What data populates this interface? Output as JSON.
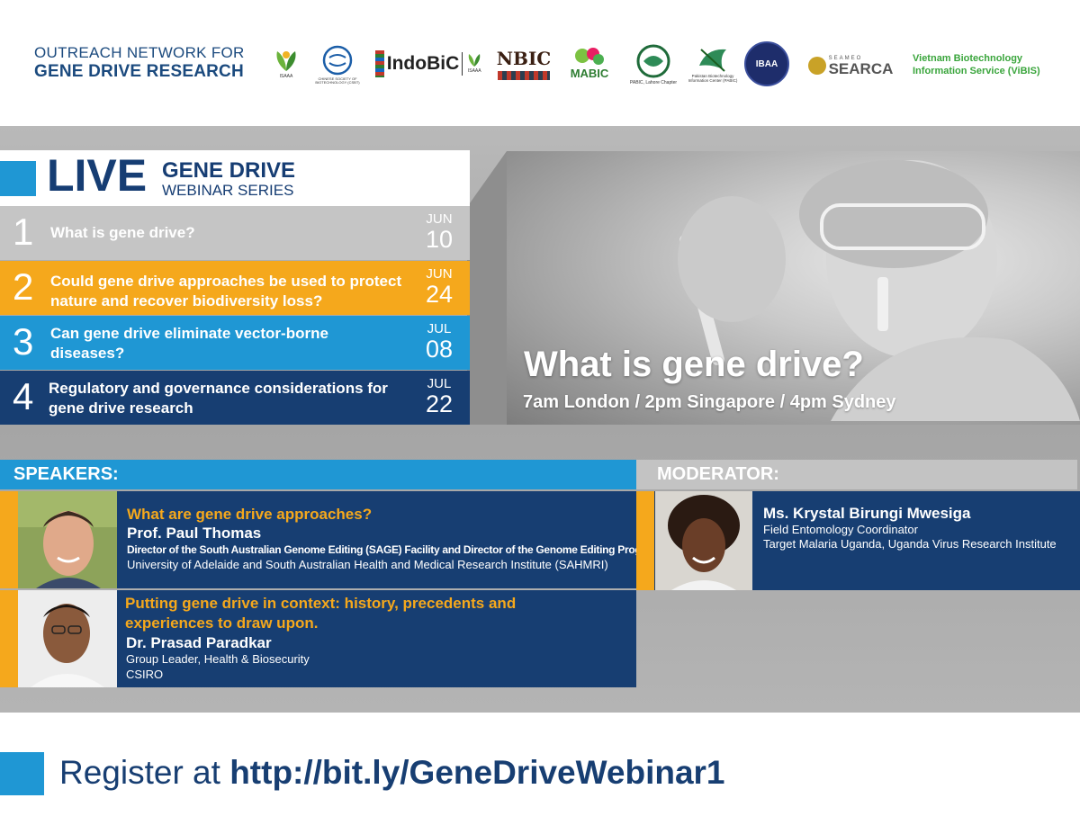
{
  "header": {
    "org_line1": "OUTREACH NETWORK FOR",
    "org_line2": "GENE DRIVE RESEARCH",
    "logos": [
      {
        "name": "isaaa",
        "text": "ISAAA"
      },
      {
        "name": "csbt",
        "text": "CHINESE SOCIETY OF BIOTECHNOLOGY (CSBT)"
      },
      {
        "name": "indobic",
        "text": "IndoBiC"
      },
      {
        "name": "indobic-isaaa",
        "text": "ISAAA"
      },
      {
        "name": "nbic",
        "text": "NBIC"
      },
      {
        "name": "mabic",
        "text": "MABIC"
      },
      {
        "name": "pabic-lahore",
        "text": "PABIC, Lahore Chapter"
      },
      {
        "name": "pabic",
        "text": "Pakistan Biotechnology Information Center (PABIC)"
      },
      {
        "name": "ibaa",
        "text": "IBAA"
      },
      {
        "name": "searca-top",
        "text": "SEAMEO"
      },
      {
        "name": "searca",
        "text": "SEARCA"
      }
    ],
    "vibis_line1": "Vietnam Biotechnology",
    "vibis_line2": "Information Service (ViBIS)"
  },
  "series": {
    "live": "LIVE",
    "title_line1": "GENE DRIVE",
    "title_line2": "WEBINAR SERIES",
    "sessions": [
      {
        "number": "1",
        "title": "What is gene drive?",
        "month": "JUN",
        "day": "10",
        "color": "#c5c5c5"
      },
      {
        "number": "2",
        "title": "Could gene drive approaches be used to protect nature and recover biodiversity loss?",
        "month": "JUN",
        "day": "24",
        "color": "#f5a81c"
      },
      {
        "number": "3",
        "title": "Can gene drive eliminate vector-borne diseases?",
        "month": "JUL",
        "day": "08",
        "color": "#1f97d4"
      },
      {
        "number": "4",
        "title": "Regulatory and governance considerations for gene drive research",
        "month": "JUL",
        "day": "22",
        "color": "#173e72"
      }
    ]
  },
  "hero": {
    "title": "What is gene drive?",
    "time": "7am London / 2pm Singapore / 4pm Sydney"
  },
  "speakers": {
    "label": "SPEAKERS:",
    "items": [
      {
        "topic": "What are gene drive approaches?",
        "name": "Prof. Paul Thomas",
        "role": "Director of the South Australian Genome Editing (SAGE) Facility and Director of the Genome Editing Program",
        "affiliation": "University of Adelaide and South Australian Health and Medical Research Institute (SAHMRI)"
      },
      {
        "topic_line1": "Putting gene drive in context: history, precedents and",
        "topic_line2": "experiences to draw upon.",
        "name": "Dr. Prasad Paradkar",
        "role": "Group Leader, Health & Biosecurity",
        "affiliation": "CSIRO"
      }
    ]
  },
  "moderator": {
    "label": "MODERATOR:",
    "name": "Ms. Krystal Birungi Mwesiga",
    "role": "Field Entomology Coordinator",
    "affiliation": "Target Malaria Uganda, Uganda Virus Research Institute"
  },
  "footer": {
    "register_prefix": "Register at ",
    "register_url": "http://bit.ly/GeneDriveWebinar1"
  }
}
